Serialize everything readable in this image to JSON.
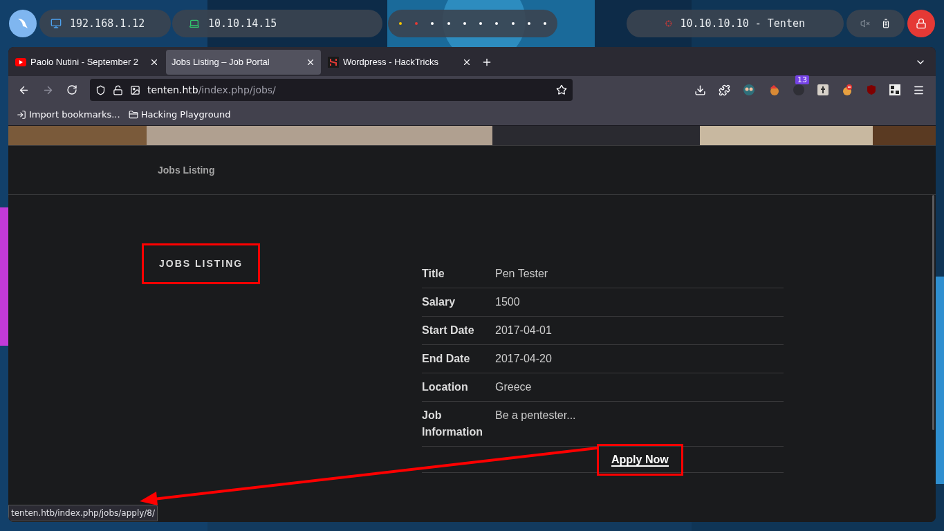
{
  "top_bar": {
    "host_ip": "192.168.1.12",
    "vpn_ip": "10.10.14.15",
    "workspaces": [
      {
        "color": "#f5c400"
      },
      {
        "color": "#e53935"
      },
      {
        "color": "#ffffff"
      },
      {
        "color": "#ffffff"
      },
      {
        "color": "#ffffff"
      },
      {
        "color": "#ffffff"
      },
      {
        "color": "#ffffff"
      },
      {
        "color": "#ffffff"
      },
      {
        "color": "#ffffff"
      },
      {
        "color": "#ffffff"
      }
    ],
    "target": "10.10.10.10 - Tenten"
  },
  "browser": {
    "tabs": [
      {
        "title": "Paolo Nutini - September 2",
        "selected": false
      },
      {
        "title": "Jobs Listing – Job Portal",
        "selected": true
      },
      {
        "title": "Wordpress - HackTricks",
        "selected": false
      }
    ],
    "url_host": "tenten.htb",
    "url_path": "/index.php/jobs/",
    "extension_badge": "13",
    "bookmarks": [
      "Import bookmarks...",
      "Hacking Playground"
    ],
    "status_url": "tenten.htb/index.php/jobs/apply/8/"
  },
  "page": {
    "nav": [
      "Jobs Listing"
    ],
    "heading": "JOBS LISTING",
    "details": [
      {
        "label": "Title",
        "value": "Pen Tester"
      },
      {
        "label": "Salary",
        "value": "1500"
      },
      {
        "label": "Start Date",
        "value": "2017-04-01"
      },
      {
        "label": "End Date",
        "value": "2017-04-20"
      },
      {
        "label": "Location",
        "value": "Greece"
      },
      {
        "label": "Job Information",
        "value": "Be a pentester..."
      }
    ],
    "apply_button": "Apply Now"
  }
}
